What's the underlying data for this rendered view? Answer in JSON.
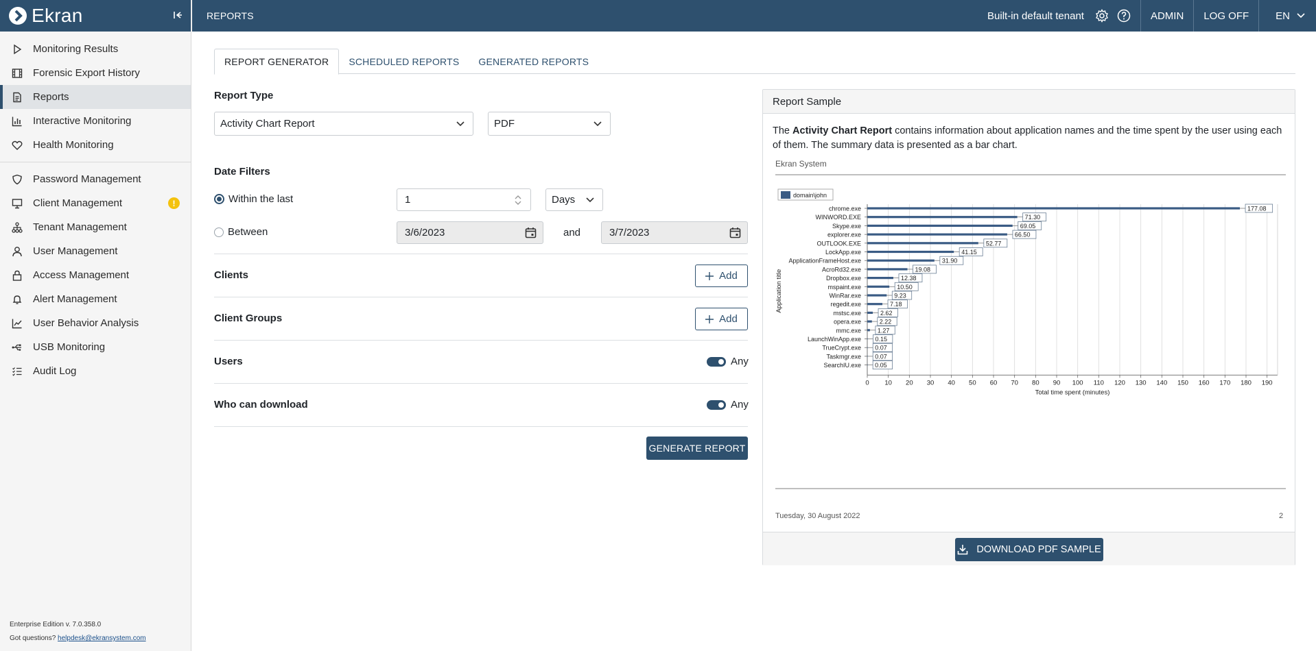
{
  "app": {
    "logo": "Ekran"
  },
  "sidebar": {
    "groups": [
      [
        {
          "label": "Monitoring Results",
          "icon": "play-icon"
        },
        {
          "label": "Forensic Export History",
          "icon": "film-icon"
        },
        {
          "label": "Reports",
          "icon": "document-icon",
          "active": true
        },
        {
          "label": "Interactive Monitoring",
          "icon": "bar-chart-icon"
        },
        {
          "label": "Health Monitoring",
          "icon": "heart-icon"
        }
      ],
      [
        {
          "label": "Password Management",
          "icon": "shield-icon"
        },
        {
          "label": "Client Management",
          "icon": "monitor-icon",
          "badge": "!"
        },
        {
          "label": "Tenant Management",
          "icon": "hierarchy-icon"
        },
        {
          "label": "User Management",
          "icon": "user-icon"
        },
        {
          "label": "Access Management",
          "icon": "lock-icon"
        },
        {
          "label": "Alert Management",
          "icon": "bell-icon"
        },
        {
          "label": "User Behavior Analysis",
          "icon": "trend-icon"
        },
        {
          "label": "USB Monitoring",
          "icon": "usb-icon"
        },
        {
          "label": "Audit Log",
          "icon": "list-icon"
        }
      ]
    ],
    "version": "Enterprise Edition v. 7.0.358.0",
    "questions": "Got questions?",
    "helpdesk": "helpdesk@ekransystem.com"
  },
  "topbar": {
    "breadcrumb": "REPORTS",
    "tenant": "Built-in default tenant",
    "user": "ADMIN",
    "logoff": "LOG OFF",
    "language": "EN"
  },
  "tabs": [
    "REPORT GENERATOR",
    "SCHEDULED REPORTS",
    "GENERATED REPORTS"
  ],
  "form": {
    "report_type_label": "Report Type",
    "report_type": "Activity Chart Report",
    "format": "PDF",
    "date_filters_label": "Date Filters",
    "within_label": "Within the last",
    "within_value": "1",
    "period_unit": "Days",
    "between_label": "Between",
    "date_from": "3/6/2023",
    "and_label": "and",
    "date_to": "3/7/2023",
    "clients_label": "Clients",
    "client_groups_label": "Client Groups",
    "users_label": "Users",
    "who_download_label": "Who can download",
    "add_label": "Add",
    "any_label": "Any",
    "generate_label": "GENERATE REPORT"
  },
  "sample": {
    "title": "Report Sample",
    "desc_prefix": "The",
    "desc_bold": "Activity Chart Report",
    "desc_rest": "contains information about application names and the time spent by the user using each of them. The summary data is presented as a bar chart.",
    "report_system": "Ekran System",
    "report_date": "Tuesday, 30 August 2022",
    "report_page": "2",
    "download_label": "DOWNLOAD PDF SAMPLE"
  },
  "chart_data": {
    "type": "bar",
    "orientation": "horizontal",
    "categories": [
      "chrome.exe",
      "WINWORD.EXE",
      "Skype.exe",
      "explorer.exe",
      "OUTLOOK.EXE",
      "LockApp.exe",
      "ApplicationFrameHost.exe",
      "AcroRd32.exe",
      "Dropbox.exe",
      "mspaint.exe",
      "WinRar.exe",
      "regedit.exe",
      "mstsc.exe",
      "opera.exe",
      "mmc.exe",
      "LaunchWinApp.exe",
      "TrueCrypt.exe",
      "Taskmgr.exe",
      "SearchIU.exe"
    ],
    "series": [
      {
        "name": "domain\\john",
        "values": [
          177.08,
          71.3,
          69.05,
          66.5,
          52.77,
          41.15,
          31.9,
          19.08,
          12.38,
          10.5,
          9.23,
          7.18,
          2.62,
          2.22,
          1.27,
          0.15,
          0.07,
          0.07,
          0.05
        ]
      }
    ],
    "value_labels": [
      "177.08",
      "71.30",
      "69.05",
      "66.50",
      "52.77",
      "41.15",
      "31.90",
      "19.08",
      "12.38",
      "10.50",
      "9.23",
      "7.18",
      "2.62",
      "2.22",
      "1.27",
      "0.15",
      "0.07",
      "0.07",
      "0.05"
    ],
    "xlabel": "Total time spent (minutes)",
    "ylabel": "Application title",
    "xlim": [
      0,
      195
    ],
    "xticks": [
      "0",
      "10",
      "20",
      "30",
      "40",
      "50",
      "60",
      "70",
      "80",
      "90",
      "100",
      "110",
      "120",
      "130",
      "140",
      "150",
      "160",
      "170",
      "180",
      "190"
    ],
    "grid": true,
    "legend": "top-left",
    "color": "#3a5b84"
  }
}
